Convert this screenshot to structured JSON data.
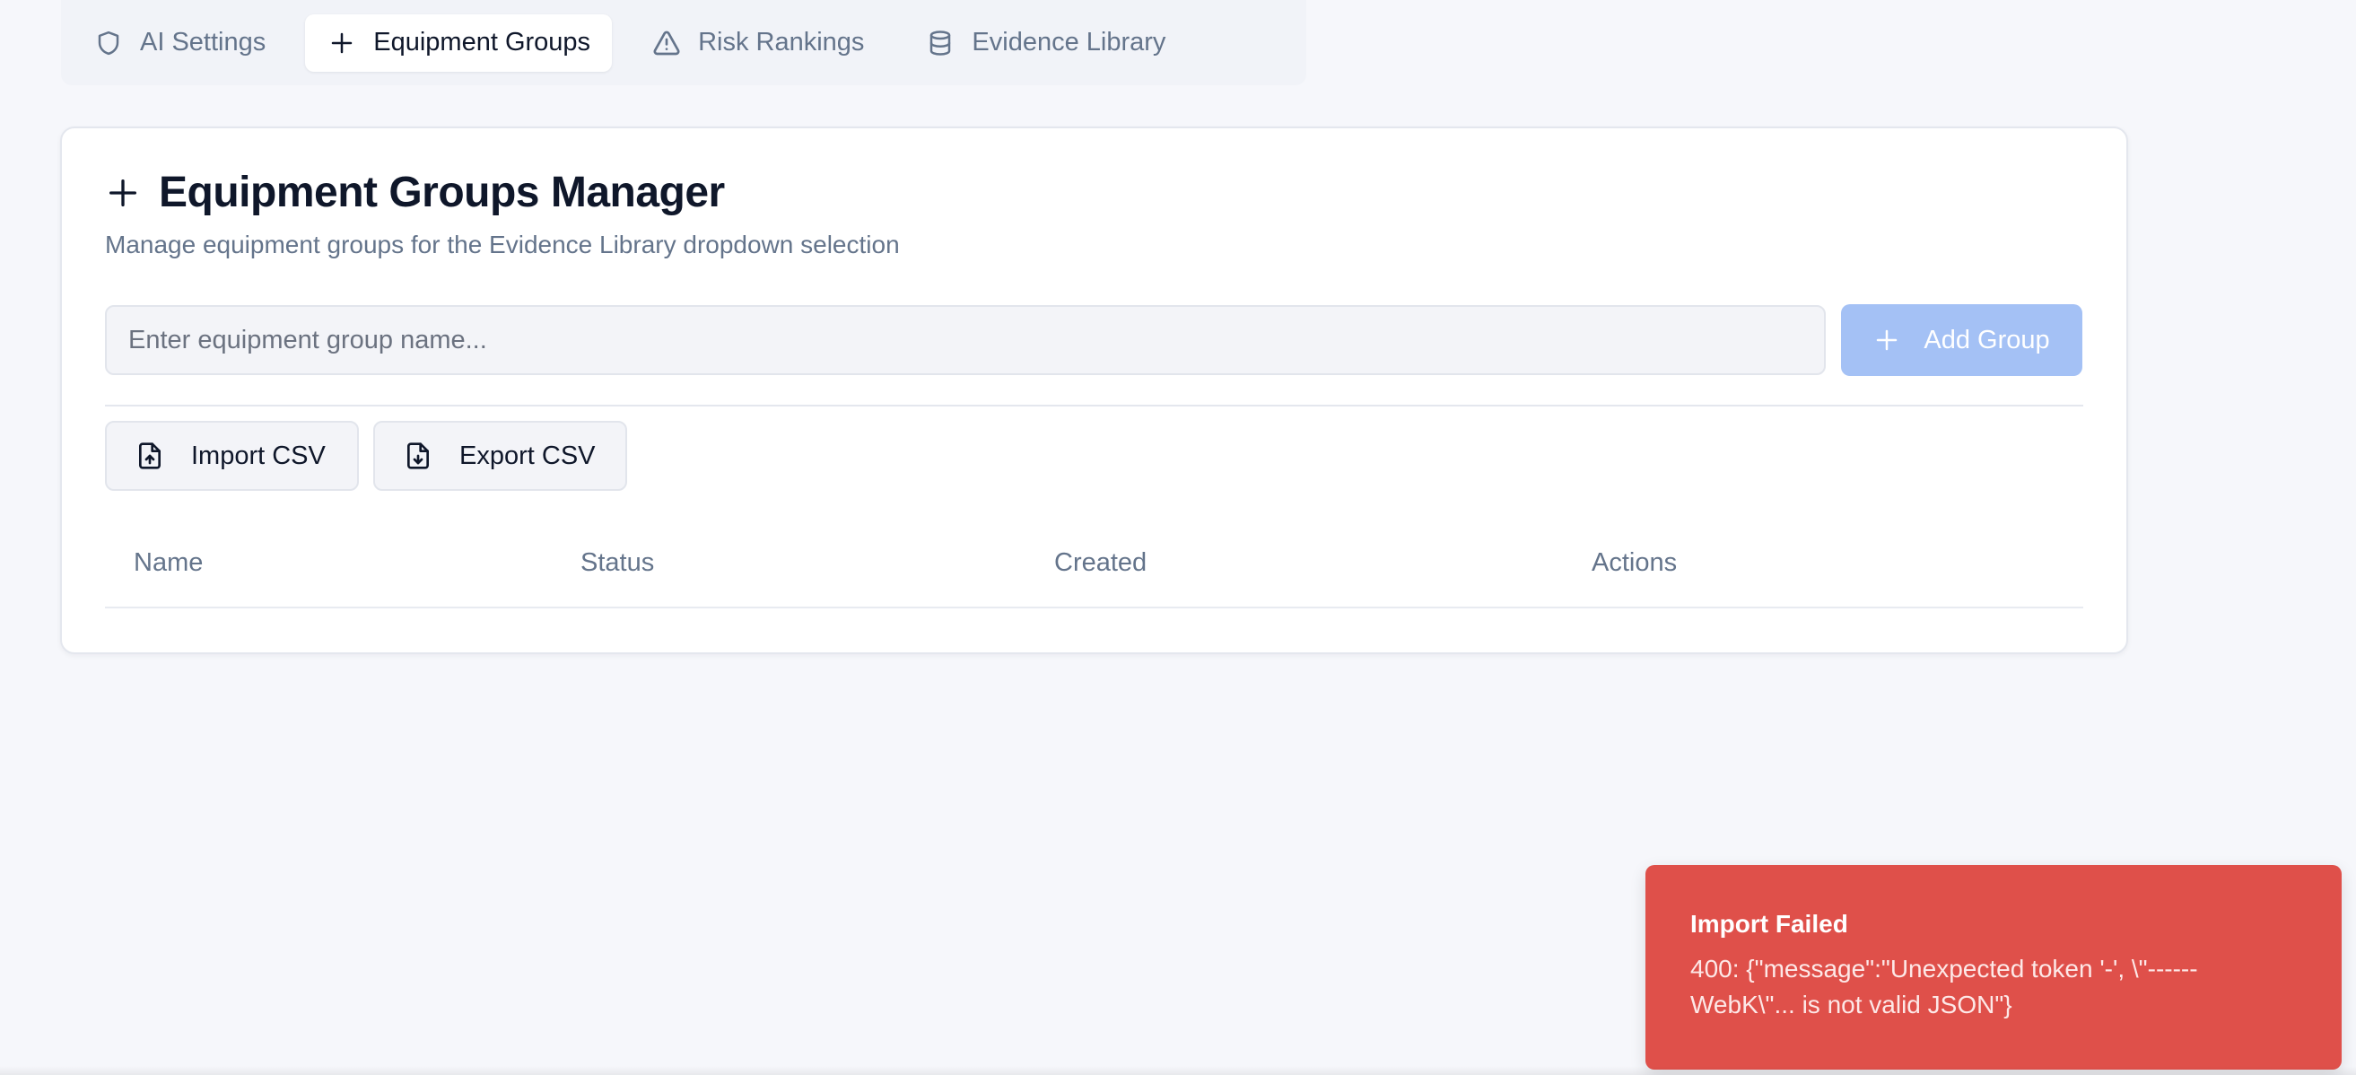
{
  "tabs": [
    {
      "label": "AI Settings",
      "icon": "shield-icon",
      "active": false
    },
    {
      "label": "Equipment Groups",
      "icon": "plus-icon",
      "active": true
    },
    {
      "label": "Risk Rankings",
      "icon": "warning-triangle-icon",
      "active": false
    },
    {
      "label": "Evidence Library",
      "icon": "database-icon",
      "active": false
    }
  ],
  "manager": {
    "title": "Equipment Groups Manager",
    "subtitle": "Manage equipment groups for the Evidence Library dropdown selection",
    "input_placeholder": "Enter equipment group name...",
    "input_value": "",
    "add_button_label": "Add Group",
    "import_label": "Import CSV",
    "export_label": "Export CSV"
  },
  "table": {
    "columns": [
      "Name",
      "Status",
      "Created",
      "Actions"
    ],
    "rows": []
  },
  "toast": {
    "title": "Import Failed",
    "message": "400: {\"message\":\"Unexpected token '-', \\\"------WebK\\\"... is not valid JSON\"}"
  },
  "colors": {
    "accent_disabled": "#a4c1f5",
    "toast_error": "#df504a",
    "muted_text": "#64748b"
  }
}
